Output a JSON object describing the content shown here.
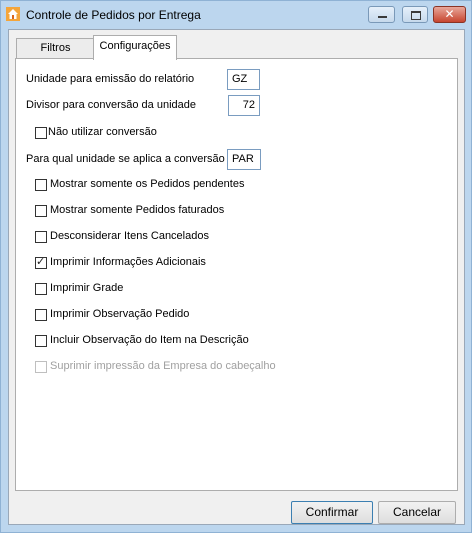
{
  "window": {
    "title": "Controle de Pedidos por Entrega",
    "app_icon": "house-icon",
    "close_glyph": "✕"
  },
  "tabs": {
    "filtros": "Filtros",
    "configuracoes": "Configurações"
  },
  "config": {
    "unidade_label": "Unidade para emissão do relatório",
    "unidade_value": "GZ",
    "divisor_label": "Divisor para conversão da unidade",
    "divisor_value": "72",
    "nao_utilizar_label": "Não utilizar conversão",
    "para_qual_label": "Para qual unidade se aplica a conversão",
    "para_qual_value": "PAR",
    "options": [
      {
        "label": "Mostrar somente os Pedidos pendentes",
        "checked": false,
        "enabled": true
      },
      {
        "label": "Mostrar somente Pedidos faturados",
        "checked": false,
        "enabled": true
      },
      {
        "label": "Desconsiderar Itens Cancelados",
        "checked": false,
        "enabled": true
      },
      {
        "label": "Imprimir Informações Adicionais",
        "checked": true,
        "enabled": true
      },
      {
        "label": "Imprimir Grade",
        "checked": false,
        "enabled": true
      },
      {
        "label": "Imprimir Observação Pedido",
        "checked": false,
        "enabled": true
      },
      {
        "label": "Incluir Observação do Item na Descrição",
        "checked": false,
        "enabled": true
      },
      {
        "label": "Suprimir impressão da Empresa do cabeçalho",
        "checked": false,
        "enabled": false
      }
    ],
    "check_glyph": "✓"
  },
  "buttons": {
    "confirm_label": "Confirmar",
    "cancel_label": "Cancelar"
  }
}
